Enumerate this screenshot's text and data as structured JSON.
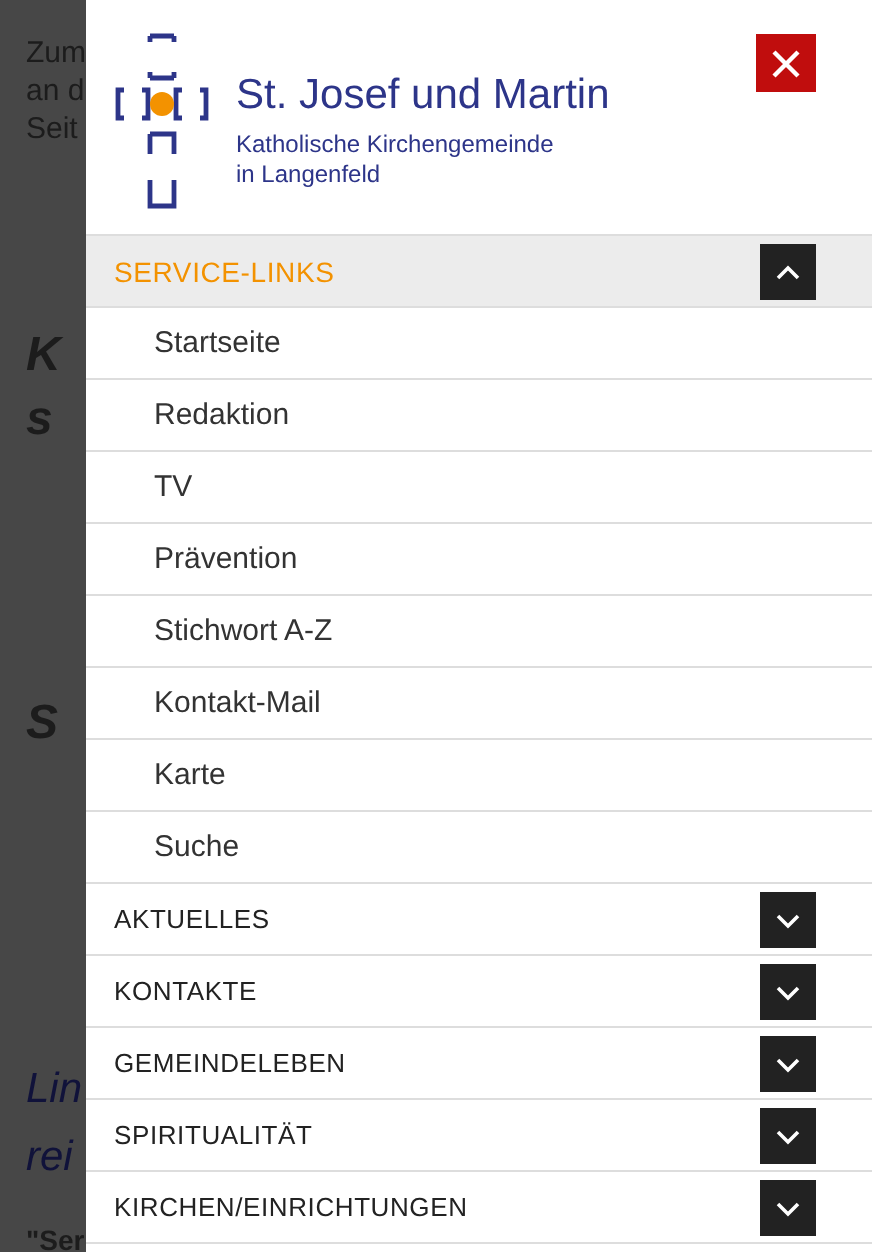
{
  "background_page": {
    "texts": [
      {
        "kind": "body",
        "text": "Zum"
      },
      {
        "kind": "body",
        "text": "an d"
      },
      {
        "kind": "body",
        "text": "Seit"
      },
      {
        "kind": "heading",
        "text": "K"
      },
      {
        "kind": "heading",
        "text": "s"
      },
      {
        "kind": "heading",
        "text": "S"
      },
      {
        "kind": "link_heading",
        "text": "Lin"
      },
      {
        "kind": "link_heading",
        "text": "rei"
      },
      {
        "kind": "quote",
        "text": "\"Ser"
      }
    ]
  },
  "menu": {
    "logo": {
      "title": "St. Josef und Martin",
      "subtitle_lines": [
        "Katholische Kirchengemeinde",
        "in Langenfeld"
      ]
    },
    "sections": [
      {
        "title": "SERVICE-LINKS",
        "expanded": true,
        "items": [
          "Startseite",
          "Redaktion",
          "TV",
          "Prävention",
          "Stichwort A-Z",
          "Kontakt-Mail",
          "Karte",
          "Suche"
        ]
      },
      {
        "title": "AKTUELLES",
        "expanded": false
      },
      {
        "title": "KONTAKTE",
        "expanded": false
      },
      {
        "title": "GEMEINDELEBEN",
        "expanded": false
      },
      {
        "title": "SPIRITUALITÄT",
        "expanded": false
      },
      {
        "title": "KIRCHEN/EINRICHTUNGEN",
        "expanded": false
      }
    ]
  }
}
